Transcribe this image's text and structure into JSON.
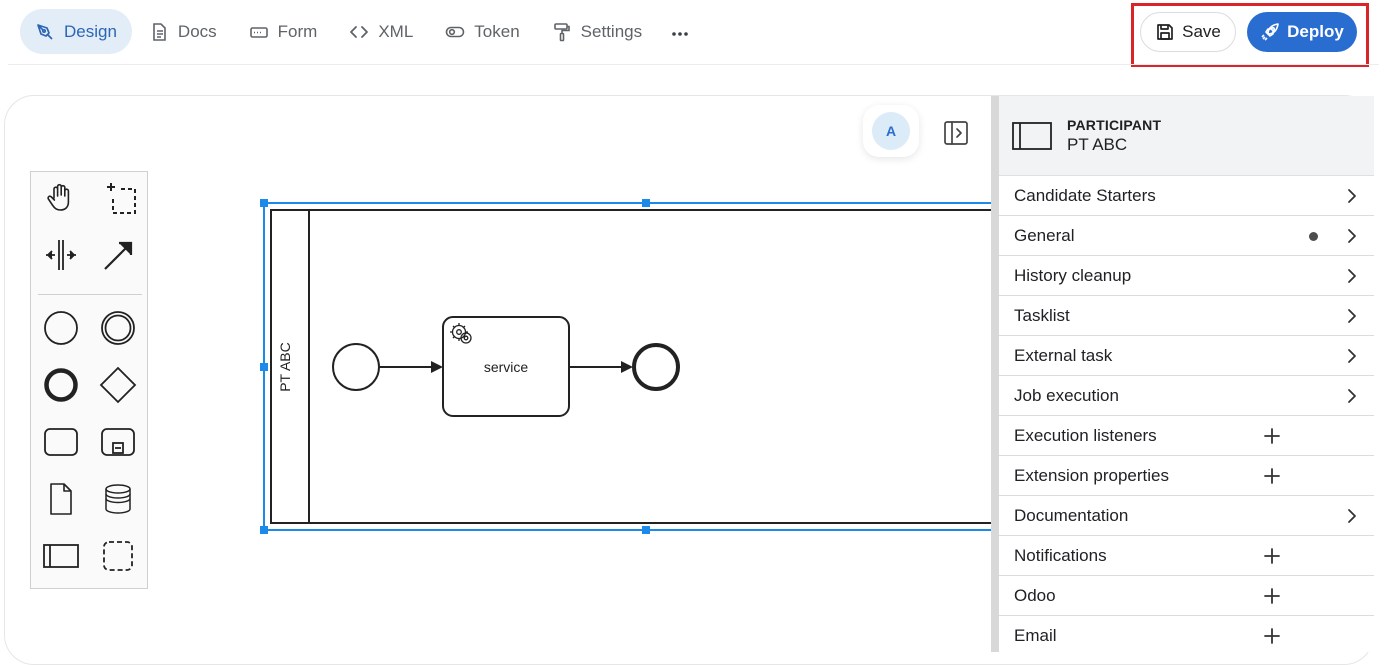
{
  "toolbar": {
    "tabs": [
      {
        "label": "Design",
        "icon": "pen-nib-icon",
        "active": true
      },
      {
        "label": "Docs",
        "icon": "document-icon",
        "active": false
      },
      {
        "label": "Form",
        "icon": "form-field-icon",
        "active": false
      },
      {
        "label": "XML",
        "icon": "code-brackets-icon",
        "active": false
      },
      {
        "label": "Token",
        "icon": "toggle-icon",
        "active": false
      },
      {
        "label": "Settings",
        "icon": "paint-roller-icon",
        "active": false
      }
    ],
    "more_icon": "more-horizontal-icon",
    "save_label": "Save",
    "deploy_label": "Deploy"
  },
  "user": {
    "avatar_initial": "A"
  },
  "diagram": {
    "participant_label": "PT ABC",
    "task_label": "service"
  },
  "properties": {
    "element_type": "PARTICIPANT",
    "element_name": "PT ABC",
    "groups": [
      {
        "label": "Candidate Starters",
        "action": "expand"
      },
      {
        "label": "General",
        "action": "expand",
        "has_dot": true
      },
      {
        "label": "History cleanup",
        "action": "expand"
      },
      {
        "label": "Tasklist",
        "action": "expand"
      },
      {
        "label": "External task",
        "action": "expand"
      },
      {
        "label": "Job execution",
        "action": "expand"
      },
      {
        "label": "Execution listeners",
        "action": "add"
      },
      {
        "label": "Extension properties",
        "action": "add"
      },
      {
        "label": "Documentation",
        "action": "expand"
      },
      {
        "label": "Notifications",
        "action": "add"
      },
      {
        "label": "Odoo",
        "action": "add"
      },
      {
        "label": "Email",
        "action": "add"
      }
    ]
  },
  "colors": {
    "accent": "#2a6dd0",
    "active_tab_bg": "#e3edf8",
    "selection": "#1b8ae8",
    "highlight": "#d9252a"
  }
}
